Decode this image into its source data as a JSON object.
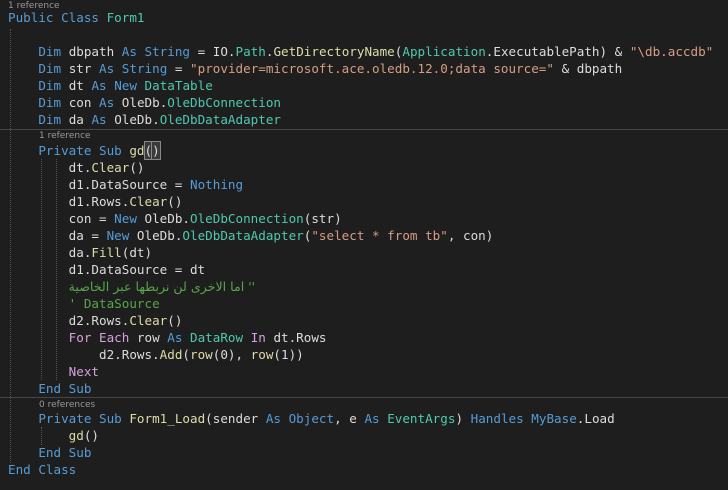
{
  "colors": {
    "background": "#1e1e1e",
    "keyword": "#569cd6",
    "control_keyword": "#d8a0df",
    "type": "#4ec9b0",
    "method": "#dcdcaa",
    "string": "#d69d85",
    "comment": "#57a64a",
    "identifier": "#dcdcdc",
    "codelens": "#999999"
  },
  "editor": {
    "codelens": [
      {
        "text": "1 reference"
      },
      {
        "text": "1 reference"
      },
      {
        "text": "0 references"
      }
    ],
    "lines": [
      [
        {
          "t": "Public Class ",
          "c": "kw"
        },
        {
          "t": "Form1",
          "c": "ty"
        }
      ],
      [],
      [
        {
          "t": "    "
        },
        {
          "t": "Dim ",
          "c": "kw"
        },
        {
          "t": "dbpath "
        },
        {
          "t": "As ",
          "c": "kw"
        },
        {
          "t": "String",
          "c": "kw"
        },
        {
          "t": " = IO."
        },
        {
          "t": "Path",
          "c": "ty"
        },
        {
          "t": "."
        },
        {
          "t": "GetDirectoryName",
          "c": "fn"
        },
        {
          "t": "("
        },
        {
          "t": "Application",
          "c": "ty"
        },
        {
          "t": ".ExecutablePath) & "
        },
        {
          "t": "\"\\db.accdb\"",
          "c": "st"
        }
      ],
      [
        {
          "t": "    "
        },
        {
          "t": "Dim ",
          "c": "kw"
        },
        {
          "t": "str "
        },
        {
          "t": "As ",
          "c": "kw"
        },
        {
          "t": "String",
          "c": "kw"
        },
        {
          "t": " = "
        },
        {
          "t": "\"provider=microsoft.ace.oledb.12.0;data source=\"",
          "c": "st"
        },
        {
          "t": " & dbpath"
        }
      ],
      [
        {
          "t": "    "
        },
        {
          "t": "Dim ",
          "c": "kw"
        },
        {
          "t": "dt "
        },
        {
          "t": "As ",
          "c": "kw"
        },
        {
          "t": "New ",
          "c": "kw"
        },
        {
          "t": "DataTable",
          "c": "ty"
        }
      ],
      [
        {
          "t": "    "
        },
        {
          "t": "Dim ",
          "c": "kw"
        },
        {
          "t": "con "
        },
        {
          "t": "As ",
          "c": "kw"
        },
        {
          "t": "OleDb."
        },
        {
          "t": "OleDbConnection",
          "c": "ty"
        }
      ],
      [
        {
          "t": "    "
        },
        {
          "t": "Dim ",
          "c": "kw"
        },
        {
          "t": "da "
        },
        {
          "t": "As ",
          "c": "kw"
        },
        {
          "t": "OleDb."
        },
        {
          "t": "OleDbDataAdapter",
          "c": "ty"
        }
      ],
      [
        {
          "t": "    "
        },
        {
          "t": "Private Sub ",
          "c": "kw"
        },
        {
          "t": "gd",
          "c": "fn"
        },
        {
          "t": "(",
          "c": "br"
        },
        {
          "t": ")",
          "c": "br"
        }
      ],
      [
        {
          "t": "        dt."
        },
        {
          "t": "Clear",
          "c": "fn"
        },
        {
          "t": "()"
        }
      ],
      [
        {
          "t": "        d1.DataSource = "
        },
        {
          "t": "Nothing",
          "c": "kw"
        }
      ],
      [
        {
          "t": "        d1.Rows."
        },
        {
          "t": "Clear",
          "c": "fn"
        },
        {
          "t": "()"
        }
      ],
      [
        {
          "t": "        con = "
        },
        {
          "t": "New ",
          "c": "kw"
        },
        {
          "t": "OleDb."
        },
        {
          "t": "OleDbConnection",
          "c": "ty"
        },
        {
          "t": "(str)"
        }
      ],
      [
        {
          "t": "        da = "
        },
        {
          "t": "New ",
          "c": "kw"
        },
        {
          "t": "OleDb."
        },
        {
          "t": "OleDbDataAdapter",
          "c": "ty"
        },
        {
          "t": "("
        },
        {
          "t": "\"select * from tb\"",
          "c": "st"
        },
        {
          "t": ", con)"
        }
      ],
      [
        {
          "t": "        da."
        },
        {
          "t": "Fill",
          "c": "fn"
        },
        {
          "t": "(dt)"
        }
      ],
      [
        {
          "t": "        d1.DataSource = dt"
        }
      ],
      [
        {
          "t": "        "
        },
        {
          "t": "'' اما الاخرى لن نربطها عبر الخاصية",
          "c": "cm-rtl"
        }
      ],
      [
        {
          "t": "        "
        },
        {
          "t": "' DataSource",
          "c": "cm"
        }
      ],
      [
        {
          "t": "        d2.Rows."
        },
        {
          "t": "Clear",
          "c": "fn"
        },
        {
          "t": "()"
        }
      ],
      [
        {
          "t": "        "
        },
        {
          "t": "For Each ",
          "c": "ctl"
        },
        {
          "t": "row "
        },
        {
          "t": "As ",
          "c": "kw"
        },
        {
          "t": "DataRow ",
          "c": "ty"
        },
        {
          "t": "In ",
          "c": "ctl"
        },
        {
          "t": "dt.Rows"
        }
      ],
      [
        {
          "t": "            d2.Rows."
        },
        {
          "t": "Add",
          "c": "fn"
        },
        {
          "t": "("
        },
        {
          "t": "row",
          "c": "fn"
        },
        {
          "t": "(0), "
        },
        {
          "t": "row",
          "c": "fn"
        },
        {
          "t": "(1))"
        }
      ],
      [
        {
          "t": "        "
        },
        {
          "t": "Next",
          "c": "ctl"
        }
      ],
      [
        {
          "t": "    "
        },
        {
          "t": "End Sub",
          "c": "kw"
        }
      ],
      [
        {
          "t": "    "
        },
        {
          "t": "Private Sub ",
          "c": "kw"
        },
        {
          "t": "Form1_Load",
          "c": "fn"
        },
        {
          "t": "(sender "
        },
        {
          "t": "As ",
          "c": "kw"
        },
        {
          "t": "Object",
          "c": "kw"
        },
        {
          "t": ", e "
        },
        {
          "t": "As ",
          "c": "kw"
        },
        {
          "t": "EventArgs",
          "c": "ty"
        },
        {
          "t": ") "
        },
        {
          "t": "Handles ",
          "c": "kw"
        },
        {
          "t": "MyBase",
          "c": "kw"
        },
        {
          "t": ".Load"
        }
      ],
      [
        {
          "t": "        "
        },
        {
          "t": "gd",
          "c": "fn"
        },
        {
          "t": "()"
        }
      ],
      [
        {
          "t": "    "
        },
        {
          "t": "End Sub",
          "c": "kw"
        }
      ],
      [
        {
          "t": "End Class",
          "c": "kw"
        }
      ]
    ]
  }
}
